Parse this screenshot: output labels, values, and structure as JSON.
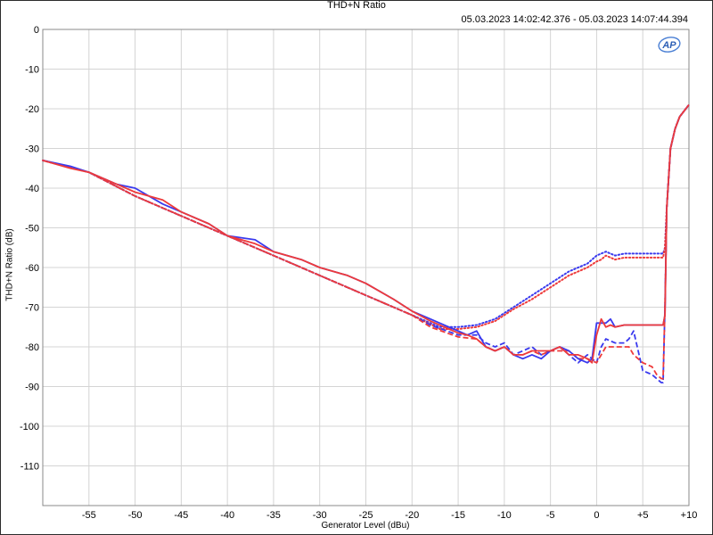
{
  "chart_data": {
    "type": "line",
    "title": "THD+N Ratio",
    "subtitle": "05.03.2023 14:02:42.376 - 05.03.2023 14:07:44.394",
    "xlabel": "Generator Level (dBu)",
    "ylabel": "THD+N Ratio (dB)",
    "xlim": [
      -60,
      10
    ],
    "ylim": [
      -120,
      0
    ],
    "grid": true,
    "logo_text": "AP",
    "x_ticks": [
      {
        "v": -55,
        "label": "-55"
      },
      {
        "v": -50,
        "label": "-50"
      },
      {
        "v": -45,
        "label": "-45"
      },
      {
        "v": -40,
        "label": "-40"
      },
      {
        "v": -35,
        "label": "-35"
      },
      {
        "v": -30,
        "label": "-30"
      },
      {
        "v": -25,
        "label": "-25"
      },
      {
        "v": -20,
        "label": "-20"
      },
      {
        "v": -15,
        "label": "-15"
      },
      {
        "v": -10,
        "label": "-10"
      },
      {
        "v": -5,
        "label": "-5"
      },
      {
        "v": 0,
        "label": "0"
      },
      {
        "v": 5,
        "label": "+5"
      },
      {
        "v": 10,
        "label": "+10"
      }
    ],
    "y_ticks": [
      {
        "v": 0,
        "label": "0"
      },
      {
        "v": -10,
        "label": "-10"
      },
      {
        "v": -20,
        "label": "-20"
      },
      {
        "v": -30,
        "label": "-30"
      },
      {
        "v": -40,
        "label": "-40"
      },
      {
        "v": -50,
        "label": "-50"
      },
      {
        "v": -60,
        "label": "-60"
      },
      {
        "v": -70,
        "label": "-70"
      },
      {
        "v": -80,
        "label": "-80"
      },
      {
        "v": -90,
        "label": "-90"
      },
      {
        "v": -100,
        "label": "-100"
      },
      {
        "v": -110,
        "label": "-110"
      }
    ],
    "series": [
      {
        "color": "#3a3aee",
        "dash": "dotted",
        "x": [
          -60,
          -55,
          -50,
          -45,
          -40,
          -35,
          -30,
          -25,
          -20,
          -17,
          -15,
          -13,
          -11,
          -9,
          -7,
          -5,
          -3,
          -1,
          0,
          0.5,
          1,
          2,
          3,
          4,
          5,
          6,
          7,
          7.2,
          7.4,
          7.6,
          8,
          8.5,
          9,
          10
        ],
        "y": [
          -33,
          -36,
          -42,
          -47,
          -52,
          -57,
          -62,
          -67,
          -72,
          -75,
          -75,
          -74.5,
          -73,
          -70,
          -67,
          -64,
          -61,
          -59,
          -57,
          -56.5,
          -56,
          -57,
          -56.5,
          -56.5,
          -56.5,
          -56.5,
          -56.5,
          -56.5,
          -55,
          -45,
          -30,
          -25,
          -22,
          -19
        ]
      },
      {
        "color": "#ee3a3a",
        "dash": "dotted",
        "x": [
          -60,
          -55,
          -50,
          -45,
          -40,
          -35,
          -30,
          -25,
          -20,
          -17,
          -15,
          -13,
          -11,
          -9,
          -7,
          -5,
          -3,
          -1,
          0,
          0.5,
          1,
          2,
          3,
          4,
          5,
          6,
          7,
          7.2,
          7.4,
          7.6,
          8,
          8.5,
          9,
          10
        ],
        "y": [
          -33,
          -36,
          -42,
          -47,
          -52,
          -57,
          -62,
          -67,
          -72,
          -75.5,
          -75.5,
          -75,
          -73.5,
          -70.5,
          -68,
          -65,
          -62,
          -60,
          -58.5,
          -58,
          -57,
          -58,
          -57.5,
          -57.5,
          -57.5,
          -57.5,
          -57.5,
          -57.5,
          -55,
          -45,
          -30,
          -25,
          -22,
          -19
        ]
      },
      {
        "color": "#3a3aee",
        "dash": "dashed",
        "x": [
          -60,
          -55,
          -50,
          -45,
          -40,
          -35,
          -30,
          -25,
          -20,
          -18,
          -15,
          -13,
          -12,
          -11,
          -10,
          -9,
          -8,
          -7,
          -6,
          -5,
          -4,
          -3,
          -2,
          -1,
          0,
          0.5,
          1,
          2,
          3,
          3.5,
          4,
          5,
          6,
          6.5,
          7,
          7.2,
          7.4,
          7.6,
          8,
          8.5,
          9,
          10
        ],
        "y": [
          -33,
          -36,
          -42,
          -47,
          -52,
          -57,
          -62,
          -67,
          -72,
          -74.5,
          -77,
          -77,
          -79,
          -80,
          -79,
          -82,
          -81,
          -80,
          -82,
          -81,
          -80,
          -82,
          -84,
          -82,
          -84,
          -80,
          -78,
          -79,
          -79,
          -78,
          -76,
          -86,
          -87,
          -88,
          -89,
          -89,
          -70,
          -45,
          -30,
          -25,
          -22,
          -19
        ]
      },
      {
        "color": "#ee3a3a",
        "dash": "dashed",
        "x": [
          -60,
          -55,
          -50,
          -45,
          -40,
          -35,
          -30,
          -25,
          -20,
          -18,
          -15,
          -13,
          -12,
          -11,
          -10,
          -9,
          -8,
          -7,
          -6,
          -5,
          -4,
          -3,
          -2,
          -1,
          0,
          0.5,
          1,
          2,
          3,
          3.5,
          4,
          5,
          6,
          6.5,
          7,
          7.2,
          7.4,
          7.6,
          8,
          8.5,
          9,
          10
        ],
        "y": [
          -33,
          -36,
          -42,
          -47,
          -52,
          -57,
          -62,
          -67,
          -72,
          -75,
          -77.5,
          -78,
          -80,
          -81,
          -80,
          -82,
          -82,
          -81,
          -82,
          -81,
          -81,
          -81,
          -83,
          -83,
          -84,
          -82,
          -80,
          -80,
          -80,
          -80,
          -82,
          -84,
          -85,
          -87,
          -88,
          -88,
          -70,
          -45,
          -30,
          -25,
          -22,
          -19
        ]
      },
      {
        "color": "#3a3aee",
        "dash": "solid",
        "x": [
          -60,
          -57,
          -55,
          -52,
          -50,
          -47,
          -45,
          -42,
          -40,
          -37,
          -35,
          -32,
          -30,
          -27,
          -25,
          -22,
          -20,
          -18,
          -16,
          -15,
          -14,
          -13,
          -12,
          -11,
          -10,
          -9,
          -8,
          -7,
          -6,
          -5,
          -4,
          -3,
          -2,
          -1,
          -0.5,
          0,
          0.5,
          1,
          1.5,
          2,
          3,
          4,
          5,
          6,
          7,
          7.2,
          7.4,
          7.6,
          8,
          8.5,
          9,
          10
        ],
        "y": [
          -33,
          -34.5,
          -36,
          -39,
          -40,
          -44,
          -46,
          -49,
          -52,
          -53,
          -56,
          -58,
          -60,
          -62,
          -64,
          -68,
          -71,
          -73,
          -75,
          -76,
          -77,
          -76,
          -80,
          -81,
          -80,
          -82,
          -83,
          -82,
          -83,
          -81,
          -80,
          -81,
          -83,
          -84,
          -83,
          -74,
          -74,
          -74,
          -73,
          -75,
          -74.5,
          -74.5,
          -74.5,
          -74.5,
          -74.5,
          -74.5,
          -72,
          -45,
          -30,
          -25,
          -22,
          -19
        ]
      },
      {
        "color": "#ee3a3a",
        "dash": "solid",
        "x": [
          -60,
          -57,
          -55,
          -52,
          -50,
          -47,
          -45,
          -42,
          -40,
          -37,
          -35,
          -32,
          -30,
          -27,
          -25,
          -22,
          -20,
          -18,
          -16,
          -15,
          -14,
          -13,
          -12,
          -11,
          -10,
          -9,
          -8,
          -7,
          -6,
          -5,
          -4,
          -3,
          -2,
          -1,
          -0.5,
          0,
          0.5,
          1,
          1.5,
          2,
          3,
          4,
          5,
          6,
          7,
          7.2,
          7.4,
          7.6,
          8,
          8.5,
          9,
          10
        ],
        "y": [
          -33,
          -35,
          -36,
          -39,
          -41,
          -43,
          -46,
          -49,
          -52,
          -54,
          -56,
          -58,
          -60,
          -62,
          -64,
          -68,
          -71,
          -73.5,
          -75.5,
          -76.5,
          -77,
          -78,
          -80,
          -81,
          -80,
          -82,
          -82,
          -81,
          -81,
          -81,
          -80,
          -82,
          -82,
          -83,
          -84,
          -77,
          -73,
          -75,
          -74.5,
          -75,
          -74.5,
          -74.5,
          -74.5,
          -74.5,
          -74.5,
          -74.5,
          -72,
          -45,
          -30,
          -25,
          -22,
          -19
        ]
      }
    ]
  }
}
